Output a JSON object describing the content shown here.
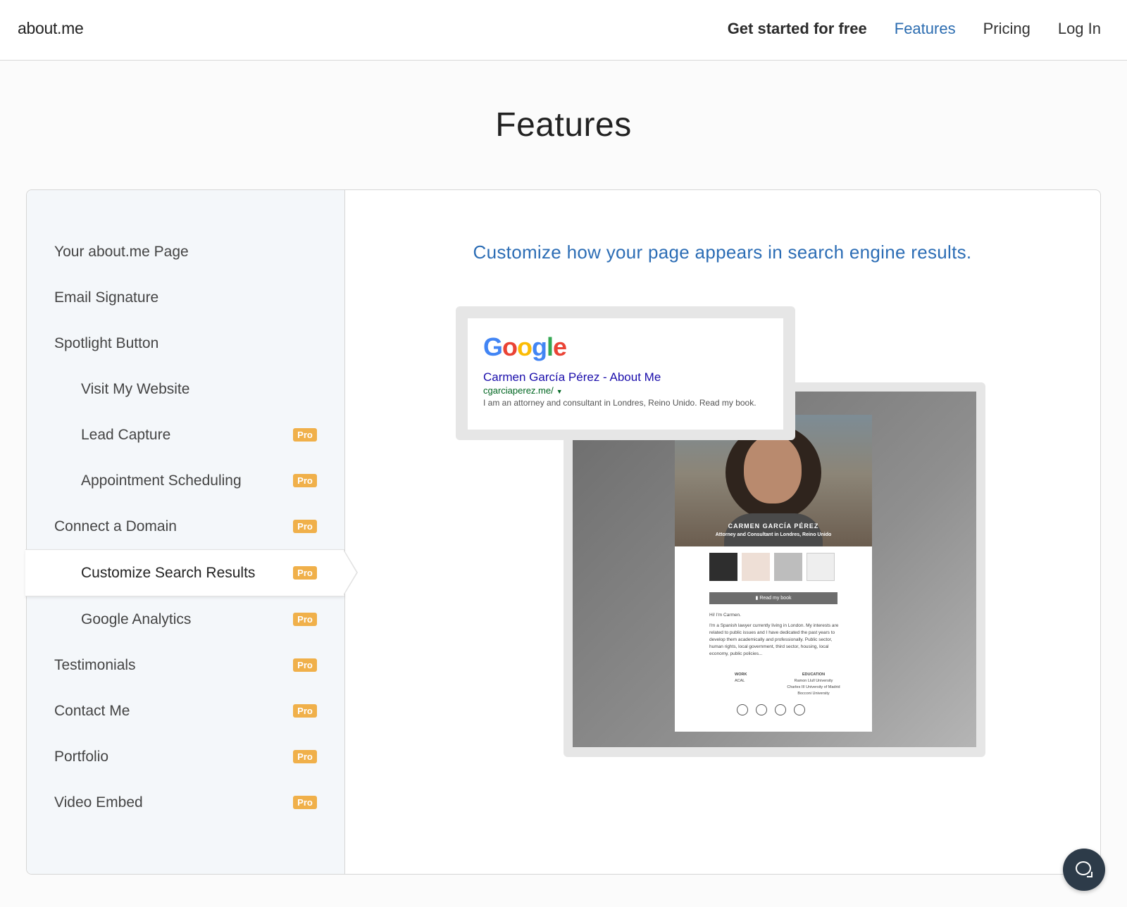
{
  "header": {
    "logo": "about.me",
    "nav": {
      "get_started": "Get started for free",
      "features": "Features",
      "pricing": "Pricing",
      "login": "Log In"
    }
  },
  "page": {
    "title": "Features"
  },
  "sidebar": {
    "items": [
      {
        "label": "Your about.me Page",
        "sub": false,
        "pro": false
      },
      {
        "label": "Email Signature",
        "sub": false,
        "pro": false
      },
      {
        "label": "Spotlight Button",
        "sub": false,
        "pro": false
      },
      {
        "label": "Visit My Website",
        "sub": true,
        "pro": false
      },
      {
        "label": "Lead Capture",
        "sub": true,
        "pro": true
      },
      {
        "label": "Appointment Scheduling",
        "sub": true,
        "pro": true
      },
      {
        "label": "Connect a Domain",
        "sub": false,
        "pro": true
      },
      {
        "label": "Customize Search Results",
        "sub": true,
        "pro": true,
        "selected": true
      },
      {
        "label": "Google Analytics",
        "sub": true,
        "pro": true
      },
      {
        "label": "Testimonials",
        "sub": false,
        "pro": true
      },
      {
        "label": "Contact Me",
        "sub": false,
        "pro": true
      },
      {
        "label": "Portfolio",
        "sub": false,
        "pro": true
      },
      {
        "label": "Video Embed",
        "sub": false,
        "pro": true
      }
    ],
    "pro_badge": "Pro"
  },
  "main": {
    "headline": "Customize how your page appears in search engine results.",
    "serp": {
      "logo_letters": [
        "G",
        "o",
        "o",
        "g",
        "l",
        "e"
      ],
      "title": "Carmen García Pérez - About Me",
      "url": "cgarciaperez.me/",
      "caret": "▼",
      "description": "I am an attorney and consultant in Londres, Reino Unido. Read my book."
    },
    "profile": {
      "name": "CARMEN GARCÍA PÉREZ",
      "subtitle": "Attorney and Consultant in Londres, Reino Unido",
      "button": "Read my book",
      "greeting": "Hi! I'm Carmen.",
      "bio": "I'm a Spanish lawyer currently living in London. My interests are related to public issues and I have dedicated the past years to develop them academically and professionally. Public sector, human rights, local government, third sector, housing, local economy, public policies...",
      "work_label": "WORK",
      "work_value": "ACAL",
      "education_label": "EDUCATION",
      "education_values": [
        "Ramon Llull University",
        "Charles III University of Madrid",
        "Bocconi University"
      ]
    }
  },
  "colors": {
    "accent": "#2c6db5",
    "pro_badge": "#f0b04a",
    "chat_button": "#2d3b49"
  }
}
